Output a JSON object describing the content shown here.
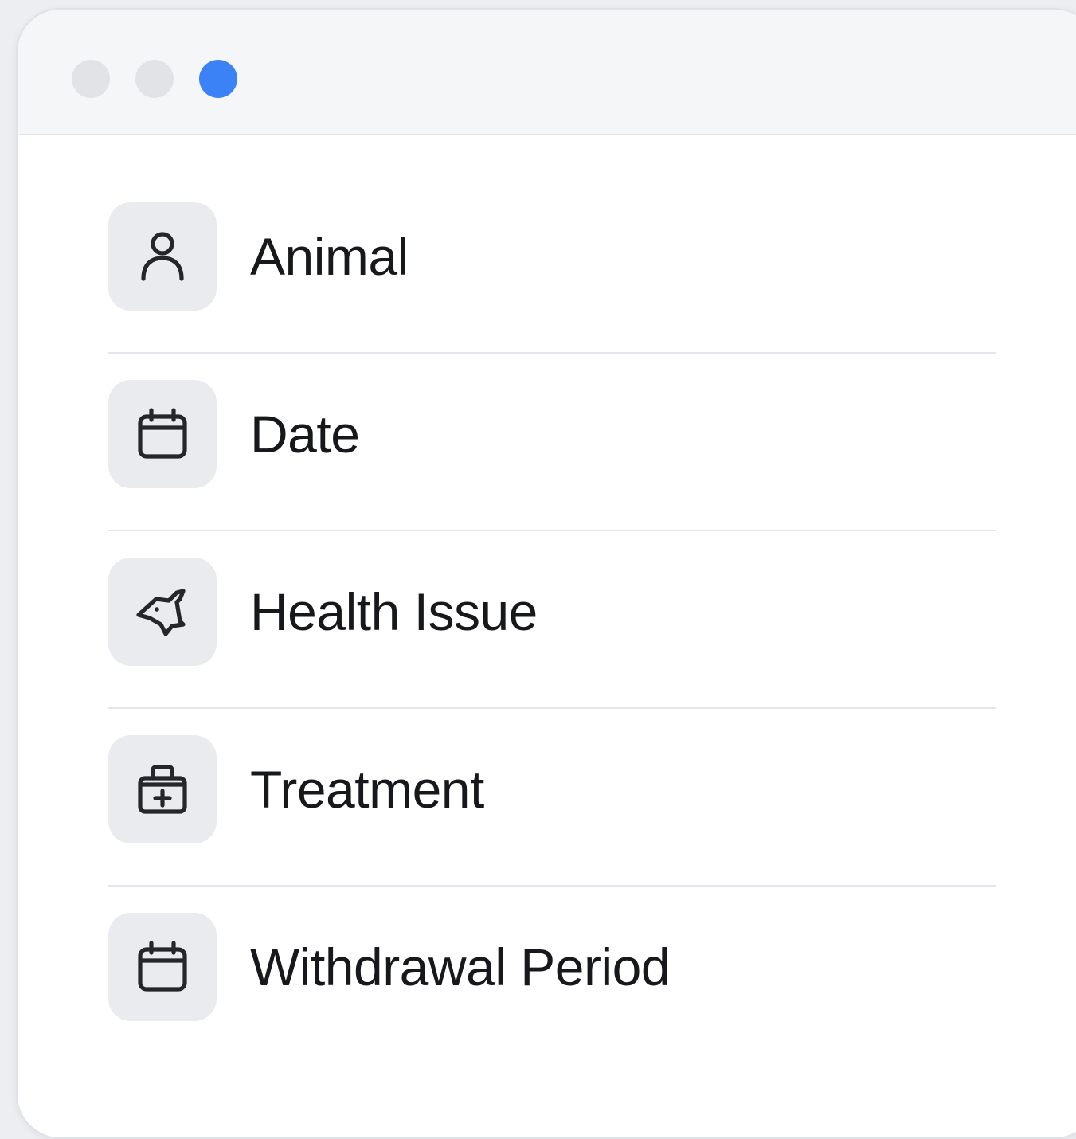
{
  "window": {
    "controls": [
      {
        "name": "window-control-1",
        "color": "#e1e3e7"
      },
      {
        "name": "window-control-2",
        "color": "#e1e3e7"
      },
      {
        "name": "window-control-active",
        "color": "#3b82f6"
      }
    ]
  },
  "form": {
    "fields": [
      {
        "label": "Animal",
        "icon": "user-icon"
      },
      {
        "label": "Date",
        "icon": "calendar-icon"
      },
      {
        "label": "Health Issue",
        "icon": "animal-head-icon"
      },
      {
        "label": "Treatment",
        "icon": "medical-kit-icon"
      },
      {
        "label": "Withdrawal Period",
        "icon": "calendar-icon"
      }
    ]
  },
  "colors": {
    "icon_stroke": "#23262b",
    "icon_bg": "#e9ebef",
    "accent": "#3b82f6"
  }
}
